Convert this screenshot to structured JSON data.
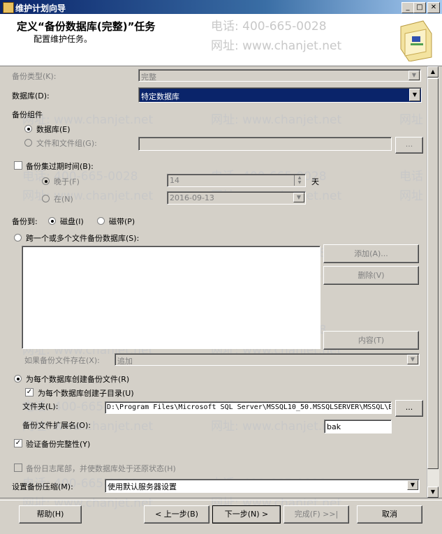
{
  "window": {
    "title": "维护计划向导"
  },
  "header": {
    "title": "定义“备份数据库(完整)”任务",
    "subtitle": "配置维护任务。"
  },
  "watermarks": [
    "电话: 400-665-0028",
    "网址: www.chanjet.net",
    "电话",
    "网址"
  ],
  "form": {
    "backup_type_label": "备份类型(K):",
    "backup_type_value": "完整",
    "database_label": "数据库(D):",
    "database_value": "特定数据库",
    "backup_component_label": "备份组件",
    "component_database": "数据库(E)",
    "component_files": "文件和文件组(G):",
    "expire_label": "备份集过期时间(B):",
    "expire_after": "晚于(F)",
    "expire_after_value": "14",
    "expire_days": "天",
    "expire_on": "在(N)",
    "expire_on_value": "2016-09-13",
    "backup_to_label": "备份到:",
    "backup_to_disk": "磁盘(I)",
    "backup_to_tape": "磁带(P)",
    "span_files": "跨一个或多个文件备份数据库(S):",
    "add_button": "添加(A)...",
    "remove_button": "删除(V)",
    "contents_button": "内容(T)",
    "if_exists_label": "如果备份文件存在(X):",
    "if_exists_value": "追加",
    "per_db_file": "为每个数据库创建备份文件(R)",
    "per_db_subdir": "为每个数据库创建子目录(U)",
    "folder_label": "文件夹(L):",
    "folder_value": "D:\\Program Files\\Microsoft SQL Server\\MSSQL10_50.MSSQLSERVER\\MSSQL\\B",
    "browse_button": "...",
    "ext_label": "备份文件扩展名(O):",
    "ext_value": "bak",
    "verify_label": "验证备份完整性(Y)",
    "tail_log_label": "备份日志尾部，并使数据库处于还原状态(H)",
    "compression_label": "设置备份压缩(M):",
    "compression_value": "使用默认服务器设置"
  },
  "footer": {
    "help": "帮助(H)",
    "back": "< 上一步(B)",
    "next": "下一步(N) >",
    "finish": "完成(F) >>|",
    "cancel": "取消"
  }
}
